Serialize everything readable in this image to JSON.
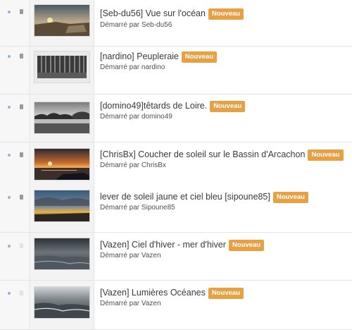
{
  "badge_label": "Nouveau",
  "started_by_label": "Démarré par",
  "colors": {
    "badge": "#e8a045",
    "unread_dot": "#8fb5dc"
  },
  "topics": [
    {
      "title": "[Seb-du56] Vue sur l'océan",
      "author": "Seb-du56",
      "thumbnail": "beach-sunset-photo"
    },
    {
      "title": "[nardino] Peupleraie",
      "author": "nardino",
      "thumbnail": "poplar-forest-photo"
    },
    {
      "title": "[domino49]têtards de Loire.",
      "author": "domino49",
      "thumbnail": "river-trees-photo"
    },
    {
      "title": "[ChrisBx] Coucher de soleil sur le Bassin d'Arcachon",
      "author": "ChrisBx",
      "thumbnail": "bay-sunset-photo"
    },
    {
      "title": "lever de soleil jaune et ciel bleu [sipoune85]",
      "author": "Sipoune85",
      "thumbnail": "cloudy-sunrise-photo"
    },
    {
      "title": "[Vazen] Ciel d'hiver - mer d'hiver",
      "author": "Vazen",
      "thumbnail": "winter-sea-photo"
    },
    {
      "title": "[Vazen] Lumières Océanes",
      "author": "Vazen",
      "thumbnail": "ocean-light-photo"
    }
  ]
}
